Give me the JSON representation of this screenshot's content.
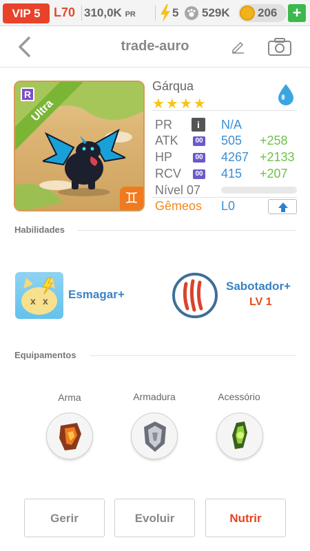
{
  "status_bar": {
    "vip": "VIP 5",
    "level": "L70",
    "power": "310,0K",
    "power_unit": "PR",
    "energy": "5",
    "food": "529K",
    "coins": "206",
    "add_label": "+"
  },
  "header": {
    "title": "trade-auro"
  },
  "monster": {
    "name": "Gárqua",
    "stars": "★★★★",
    "rarity_tag": "Ultra",
    "rank_badge": "R",
    "zodiac_symbol": "♊",
    "element_color": "#3aa6e0",
    "stats": [
      {
        "label": "PR",
        "value": "N/A",
        "bonus": "",
        "chip": "i"
      },
      {
        "label": "ATK",
        "value": "505",
        "bonus": "+258",
        "chip": "00"
      },
      {
        "label": "HP",
        "value": "4267",
        "bonus": "+2133",
        "chip": "00"
      },
      {
        "label": "RCV",
        "value": "415",
        "bonus": "+207",
        "chip": "00"
      }
    ],
    "level_label": "Nível 07",
    "level_progress": 0,
    "twins_label": "Gêmeos",
    "twins_value": "L0"
  },
  "sections": {
    "skills": "Habilidades",
    "equipment": "Equipamentos"
  },
  "skills": [
    {
      "name": "Esmagar+",
      "icon": "smash-cat-icon"
    },
    {
      "name": "Sabotador+",
      "level": "LV 1",
      "icon": "claw-scratch-icon"
    }
  ],
  "equipment": [
    {
      "label": "Arma",
      "icon": "weapon-icon"
    },
    {
      "label": "Armadura",
      "icon": "armor-icon"
    },
    {
      "label": "Acessório",
      "icon": "accessory-icon"
    }
  ],
  "actions": {
    "manage": "Gerir",
    "evolve": "Evoluir",
    "feed": "Nutrir"
  }
}
